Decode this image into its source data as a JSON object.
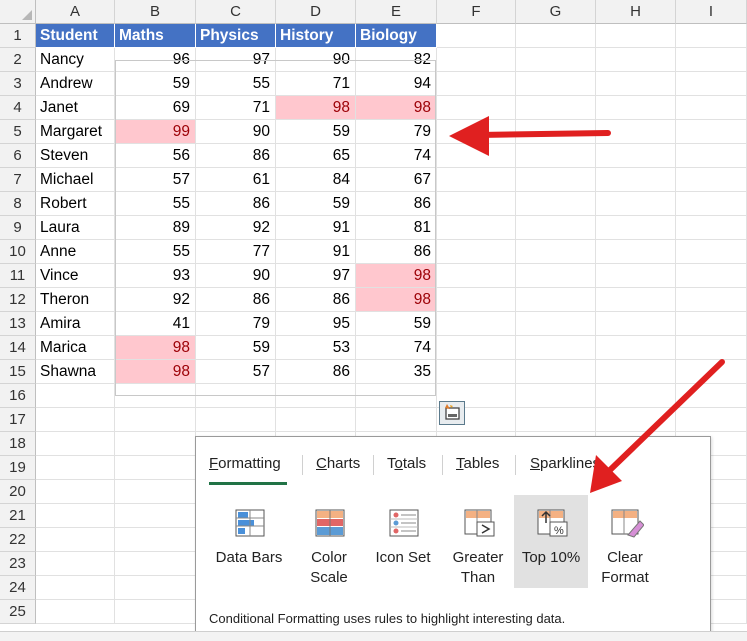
{
  "columns": [
    "A",
    "B",
    "C",
    "D",
    "E",
    "F",
    "G",
    "H",
    "I"
  ],
  "row_numbers": [
    "1",
    "2",
    "3",
    "4",
    "5",
    "6",
    "7",
    "8",
    "9",
    "10",
    "11",
    "12",
    "13",
    "14",
    "15",
    "16",
    "17",
    "18",
    "19",
    "20",
    "21",
    "22",
    "23",
    "24",
    "25"
  ],
  "table": {
    "headers": [
      "Student",
      "Maths",
      "Physics",
      "History",
      "Biology"
    ],
    "rows": [
      [
        "Nancy",
        "96",
        "97",
        "90",
        "82"
      ],
      [
        "Andrew",
        "59",
        "55",
        "71",
        "94"
      ],
      [
        "Janet",
        "69",
        "71",
        "98",
        "98"
      ],
      [
        "Margaret",
        "99",
        "90",
        "59",
        "79"
      ],
      [
        "Steven",
        "56",
        "86",
        "65",
        "74"
      ],
      [
        "Michael",
        "57",
        "61",
        "84",
        "67"
      ],
      [
        "Robert",
        "55",
        "86",
        "59",
        "86"
      ],
      [
        "Laura",
        "89",
        "92",
        "91",
        "81"
      ],
      [
        "Anne",
        "55",
        "77",
        "91",
        "86"
      ],
      [
        "Vince",
        "93",
        "90",
        "97",
        "98"
      ],
      [
        "Theron",
        "92",
        "86",
        "86",
        "98"
      ],
      [
        "Amira",
        "41",
        "79",
        "95",
        "59"
      ],
      [
        "Marica",
        "98",
        "59",
        "53",
        "74"
      ],
      [
        "Shawna",
        "98",
        "57",
        "86",
        "35"
      ]
    ],
    "highlighted": [
      [
        2,
        3
      ],
      [
        2,
        4
      ],
      [
        3,
        1
      ],
      [
        9,
        4
      ],
      [
        10,
        4
      ],
      [
        12,
        1
      ],
      [
        13,
        1
      ]
    ],
    "highlight_fill": "#ffc7ce",
    "highlight_text": "#9c0006",
    "header_fill": "#4472c4"
  },
  "quick_analysis": {
    "button_icon": "quick-analysis-icon",
    "tabs": [
      {
        "label": "Formatting",
        "underline": "F",
        "active": true
      },
      {
        "label": "Charts",
        "underline": "C",
        "active": false
      },
      {
        "label": "Totals",
        "underline": "o",
        "active": false
      },
      {
        "label": "Tables",
        "underline": "T",
        "active": false
      },
      {
        "label": "Sparklines",
        "underline": "S",
        "active": false
      }
    ],
    "tools": [
      {
        "label": "Data Bars",
        "icon": "data-bars-icon",
        "active": false
      },
      {
        "label": "Color\nScale",
        "icon": "color-scale-icon",
        "active": false
      },
      {
        "label": "Icon Set",
        "icon": "icon-set-icon",
        "active": false
      },
      {
        "label": "Greater\nThan",
        "icon": "greater-than-icon",
        "active": false
      },
      {
        "label": "Top 10%",
        "icon": "top-10-percent-icon",
        "active": true
      },
      {
        "label": "Clear\nFormat",
        "icon": "clear-format-icon",
        "active": false
      }
    ],
    "description": "Conditional Formatting uses rules to highlight interesting data."
  },
  "annotation_color": "#e02020"
}
